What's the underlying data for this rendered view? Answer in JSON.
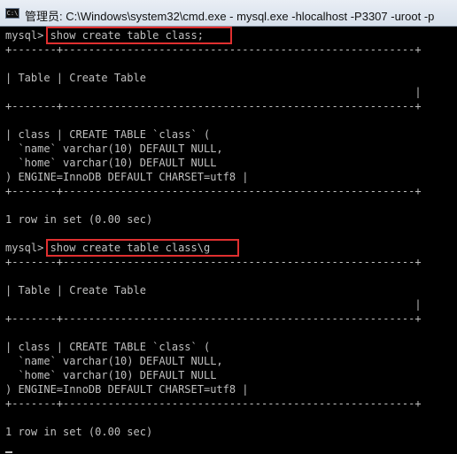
{
  "window": {
    "title": "管理员: C:\\Windows\\system32\\cmd.exe - mysql.exe  -hlocalhost -P3307 -uroot -p",
    "icon": "cmd-icon",
    "icon_glyph": "C:\\"
  },
  "console": {
    "lines": [
      "mysql> show create table class;",
      "+-------+-------------------------------------------------------+",
      "",
      "| Table | Create Table",
      "                                                                |",
      "+-------+-------------------------------------------------------+",
      "",
      "| class | CREATE TABLE `class` (",
      "  `name` varchar(10) DEFAULT NULL,",
      "  `home` varchar(10) DEFAULT NULL",
      ") ENGINE=InnoDB DEFAULT CHARSET=utf8 |",
      "+-------+-------------------------------------------------------+",
      "",
      "1 row in set (0.00 sec)",
      "",
      "mysql> show create table class\\g",
      "+-------+-------------------------------------------------------+",
      "",
      "| Table | Create Table",
      "                                                                |",
      "+-------+-------------------------------------------------------+",
      "",
      "| class | CREATE TABLE `class` (",
      "  `name` varchar(10) DEFAULT NULL,",
      "  `home` varchar(10) DEFAULT NULL",
      ") ENGINE=InnoDB DEFAULT CHARSET=utf8 |",
      "+-------+-------------------------------------------------------+",
      "",
      "1 row in set (0.00 sec)",
      ""
    ]
  }
}
